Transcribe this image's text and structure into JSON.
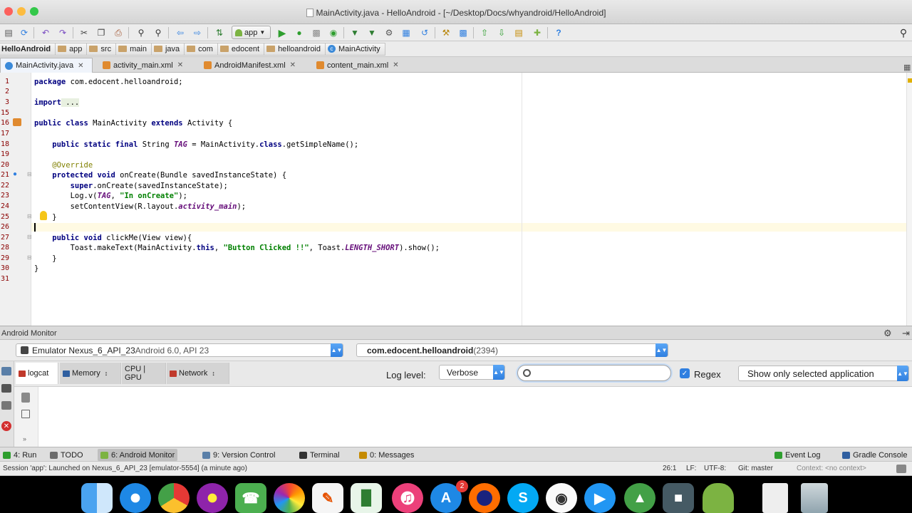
{
  "window": {
    "title": "MainActivity.java - HelloAndroid - [~/Desktop/Docs/whyandroid/HelloAndroid]",
    "traffic_colors": [
      "#fc605c",
      "#fdbc40",
      "#34c84a"
    ]
  },
  "toolbar": {
    "run_config": "app",
    "help_label": "?"
  },
  "breadcrumb": [
    {
      "label": "HelloAndroid",
      "icon": "project"
    },
    {
      "label": "app",
      "icon": "folder-icon"
    },
    {
      "label": "src",
      "icon": "folder-icon"
    },
    {
      "label": "main",
      "icon": "folder-icon"
    },
    {
      "label": "java",
      "icon": "folder-icon"
    },
    {
      "label": "com",
      "icon": "folder-icon"
    },
    {
      "label": "edocent",
      "icon": "folder-icon"
    },
    {
      "label": "helloandroid",
      "icon": "folder-icon"
    },
    {
      "label": "MainActivity",
      "icon": "class-icon"
    }
  ],
  "tabs": [
    {
      "label": "MainActivity.java",
      "active": true
    },
    {
      "label": "activity_main.xml",
      "active": false
    },
    {
      "label": "AndroidManifest.xml",
      "active": false
    },
    {
      "label": "content_main.xml",
      "active": false
    }
  ],
  "editor": {
    "line_numbers": [
      "1",
      "2",
      "3",
      "15",
      "16",
      "17",
      "18",
      "19",
      "20",
      "21",
      "22",
      "23",
      "24",
      "25",
      "26",
      "27",
      "28",
      "29",
      "30",
      "31"
    ],
    "lines": {
      "l1a": "package",
      "l1b": " com.edocent.helloandroid;",
      "l3a": "import",
      "l3b": " ...",
      "l16a": "public class",
      "l16b": " MainActivity ",
      "l16c": "extends",
      "l16d": " Activity {",
      "l18a": "    public static final",
      "l18b": " String ",
      "l18c": "TAG",
      "l18d": " = MainActivity.",
      "l18e": "class",
      "l18f": ".getSimpleName();",
      "l20": "    @Override",
      "l21a": "    protected void",
      "l21b": " onCreate(Bundle savedInstanceState) {",
      "l22a": "        super",
      "l22b": ".onCreate(savedInstanceState);",
      "l23a": "        Log.v(",
      "l23b": "TAG",
      "l23c": ", ",
      "l23d": "\"In onCreate\"",
      "l23e": ");",
      "l24a": "        setContentView(R.layout.",
      "l24b": "activity_main",
      "l24c": ");",
      "l25": "    }",
      "l27a": "    public void",
      "l27b": " clickMe(View view){",
      "l28a": "        Toast.makeText(MainActivity.",
      "l28b": "this",
      "l28c": ", ",
      "l28d": "\"Button Clicked !!\"",
      "l28e": ", Toast.",
      "l28f": "LENGTH_SHORT",
      "l28g": ").show();",
      "l29": "    }",
      "l30": "}"
    }
  },
  "monitor": {
    "title": "Android Monitor",
    "device": "Emulator Nexus_6_API_23",
    "device_detail": " Android 6.0, API 23",
    "process": "com.edocent.helloandroid",
    "process_pid": " (2394)",
    "tabs": [
      "logcat",
      "Memory",
      "CPU | GPU",
      "Network"
    ],
    "log_level_label": "Log level:",
    "log_level_value": "Verbose",
    "search_value": "",
    "regex_label": "Regex",
    "filter_value": "Show only selected application"
  },
  "tool_tabs": [
    {
      "label": "4: Run"
    },
    {
      "label": "TODO"
    },
    {
      "label": "6: Android Monitor"
    },
    {
      "label": "9: Version Control"
    },
    {
      "label": "Terminal"
    },
    {
      "label": "0: Messages"
    },
    {
      "label": "Event Log"
    },
    {
      "label": "Gradle Console"
    }
  ],
  "status": {
    "message": "Session 'app': Launched on Nexus_6_API_23 [emulator-5554] (a minute ago)",
    "position": "26:1",
    "line_sep": "LF:",
    "encoding": "UTF-8:",
    "git": "Git: master",
    "context": "Context: <no context>"
  },
  "dock": {
    "badge": "2"
  }
}
